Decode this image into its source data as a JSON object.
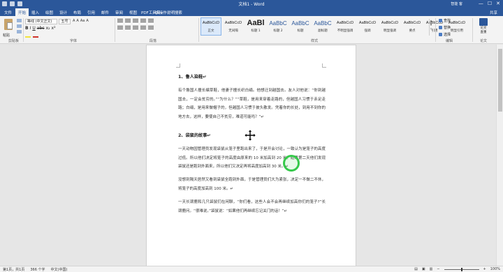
{
  "titlebar": {
    "title": "文档1 - Word",
    "user": "智能 客",
    "min": "—",
    "max": "☐",
    "close": "✕"
  },
  "tabs": {
    "file": "文件",
    "items": [
      "开始",
      "插入",
      "绘图",
      "设计",
      "布局",
      "引用",
      "邮件",
      "审阅",
      "视图",
      "PDF工具集"
    ],
    "tellme": "♀ 操作说明搜索",
    "share": "共享"
  },
  "ribbon": {
    "clipboard": {
      "paste": "粘贴",
      "label": "剪贴板"
    },
    "font": {
      "name": "等线 (中文正文)",
      "size": "五号",
      "format_buttons": [
        "B",
        "I",
        "U",
        "abc",
        "x₂",
        "x²"
      ],
      "grow_shrink": [
        "A",
        "A",
        "Aa",
        "A"
      ],
      "label": "字体",
      "highlight_color": "#f2e33c",
      "font_color": "#d0342c"
    },
    "paragraph": {
      "label": "段落"
    },
    "styles": {
      "label": "样式",
      "items": [
        {
          "sample": "AaBbCcD",
          "name": "正文",
          "selected": true
        },
        {
          "sample": "AaBbCcD",
          "name": "无间隔"
        },
        {
          "sample": "AaBl",
          "name": "标题 1"
        },
        {
          "sample": "AaBbC",
          "name": "标题 2"
        },
        {
          "sample": "AaBbC",
          "name": "标题"
        },
        {
          "sample": "AaBbC",
          "name": "副标题"
        },
        {
          "sample": "AaBbCcD",
          "name": "不明显强调"
        },
        {
          "sample": "AaBbCcD",
          "name": "强调"
        },
        {
          "sample": "AaBbCcD",
          "name": "明显强调"
        },
        {
          "sample": "AaBbCcD",
          "name": "要点"
        },
        {
          "sample": "AaBbCcD",
          "name": "引用"
        },
        {
          "sample": "AaBbCcD",
          "name": "明显引用"
        }
      ]
    },
    "editing": {
      "find": "查找",
      "replace": "替换",
      "select": "选择",
      "label": "编辑"
    },
    "paperwork": {
      "line1": "论文",
      "line2": "查重",
      "label": "论文"
    }
  },
  "document": {
    "heading1": "1、鲁人染鞋↵",
    "para1": "有个鲁国人擅长编草鞋，他妻子擅长织白绢。他想迁到越国去。友人对他说：“你到越国去，一定会贫穷的。”“为什么？”“草鞋，是用来穿着走路的，但越国人习惯于赤足走路；白绢，是用来做帽子的，但越国人习惯于披头散发。凭着你的长处，到用不到你的地方去，这样，要使自己不贫穷，难道可能吗？”↵",
    "heading2": "2、袋鼠的故事↵",
    "para2": "一天动物园管理员发现袋鼠从笼子里跑出来了，于是开会讨论，一致认为是笼子的高度过低。所以他们决定将笼子的高度由原来的 10 米加高到 20 米。结果第二天他们发现袋鼠还是跑到外面来，所以他们又决定再将高度加高到 30 米。↵",
    "para3": "没想到隔天居然又看到袋鼠全跑到外面，于是管理员们大为紧张，决定一不做二不休，将笼子的高度加高到 100 米。↵",
    "para4": "一天长颈鹿和几只袋鼠们在闲聊，“你们看，这些人会不会再继续加高你们的笼子?”长颈鹿问。“很难说。”袋鼠说：“如果他们再继续忘记关门的话！”↵"
  },
  "statusbar": {
    "page": "第1页，共1页",
    "words": "366 个字",
    "language": "中文(中国)",
    "zoom_level": "100%"
  }
}
